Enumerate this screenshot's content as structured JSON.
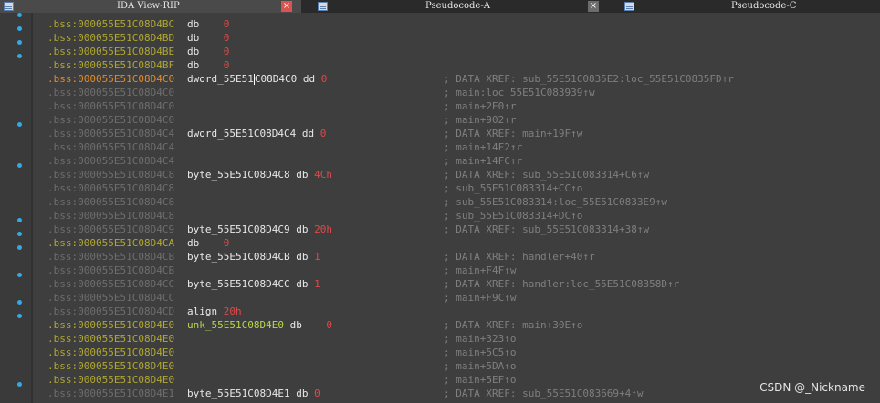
{
  "tabs": [
    {
      "label": "IDA View-RIP",
      "close": "×"
    },
    {
      "label": "Pseudocode-A",
      "close": "×"
    },
    {
      "label": "Pseudocode-C"
    }
  ],
  "rows": [
    {
      "addr": ".bss:000055E51C08D4BC",
      "addr_style": "bright",
      "name": "",
      "dir": "db",
      "val": "0",
      "cmt": "",
      "dot": true
    },
    {
      "addr": ".bss:000055E51C08D4BD",
      "addr_style": "bright",
      "name": "",
      "dir": "db",
      "val": "0",
      "cmt": "",
      "dot": true
    },
    {
      "addr": ".bss:000055E51C08D4BE",
      "addr_style": "bright",
      "name": "",
      "dir": "db",
      "val": "0",
      "cmt": "",
      "dot": true
    },
    {
      "addr": ".bss:000055E51C08D4BF",
      "addr_style": "bright",
      "name": "",
      "dir": "db",
      "val": "0",
      "cmt": "",
      "dot": true
    },
    {
      "addr": ".bss:000055E51C08D4C0",
      "addr_style": "sel",
      "name": "dword_55E51C08D4C0",
      "dir": "dd",
      "val": "0",
      "cmt": "; DATA XREF: sub_55E51C0835E2:loc_55E51C0835FD↑r",
      "dot": false,
      "cursor": true
    },
    {
      "addr": ".bss:000055E51C08D4C0",
      "addr_style": "dim",
      "name": "",
      "dir": "",
      "val": "",
      "cmt": "; main:loc_55E51C083939↑w",
      "dot": false
    },
    {
      "addr": ".bss:000055E51C08D4C0",
      "addr_style": "dim",
      "name": "",
      "dir": "",
      "val": "",
      "cmt": "; main+2E0↑r",
      "dot": false
    },
    {
      "addr": ".bss:000055E51C08D4C0",
      "addr_style": "dim",
      "name": "",
      "dir": "",
      "val": "",
      "cmt": "; main+902↑r",
      "dot": false
    },
    {
      "addr": ".bss:000055E51C08D4C4",
      "addr_style": "dim",
      "name": "dword_55E51C08D4C4",
      "dir": "dd",
      "val": "0",
      "cmt": "; DATA XREF: main+19F↑w",
      "dot": true
    },
    {
      "addr": ".bss:000055E51C08D4C4",
      "addr_style": "dim",
      "name": "",
      "dir": "",
      "val": "",
      "cmt": "; main+14F2↑r",
      "dot": false
    },
    {
      "addr": ".bss:000055E51C08D4C4",
      "addr_style": "dim",
      "name": "",
      "dir": "",
      "val": "",
      "cmt": "; main+14FC↑r",
      "dot": false
    },
    {
      "addr": ".bss:000055E51C08D4C8",
      "addr_style": "dim",
      "name": "byte_55E51C08D4C8",
      "dir": "db",
      "val": "4Ch",
      "cmt": "; DATA XREF: sub_55E51C083314+C6↑w",
      "dot": true
    },
    {
      "addr": ".bss:000055E51C08D4C8",
      "addr_style": "dim",
      "name": "",
      "dir": "",
      "val": "",
      "cmt": "; sub_55E51C083314+CC↑o",
      "dot": false
    },
    {
      "addr": ".bss:000055E51C08D4C8",
      "addr_style": "dim",
      "name": "",
      "dir": "",
      "val": "",
      "cmt": "; sub_55E51C083314:loc_55E51C0833E9↑w",
      "dot": false
    },
    {
      "addr": ".bss:000055E51C08D4C8",
      "addr_style": "dim",
      "name": "",
      "dir": "",
      "val": "",
      "cmt": "; sub_55E51C083314+DC↑o",
      "dot": false
    },
    {
      "addr": ".bss:000055E51C08D4C9",
      "addr_style": "dim",
      "name": "byte_55E51C08D4C9",
      "dir": "db",
      "val": "20h",
      "cmt": "; DATA XREF: sub_55E51C083314+38↑w",
      "dot": true
    },
    {
      "addr": ".bss:000055E51C08D4CA",
      "addr_style": "bright",
      "name": "",
      "dir": "db",
      "val": "0",
      "cmt": "",
      "dot": true
    },
    {
      "addr": ".bss:000055E51C08D4CB",
      "addr_style": "dim",
      "name": "byte_55E51C08D4CB",
      "dir": "db",
      "val": "1",
      "cmt": "; DATA XREF: handler+40↑r",
      "dot": true
    },
    {
      "addr": ".bss:000055E51C08D4CB",
      "addr_style": "dim",
      "name": "",
      "dir": "",
      "val": "",
      "cmt": "; main+F4F↑w",
      "dot": false
    },
    {
      "addr": ".bss:000055E51C08D4CC",
      "addr_style": "dim",
      "name": "byte_55E51C08D4CC",
      "dir": "db",
      "val": "1",
      "cmt": "; DATA XREF: handler:loc_55E51C08358D↑r",
      "dot": true
    },
    {
      "addr": ".bss:000055E51C08D4CC",
      "addr_style": "dim",
      "name": "",
      "dir": "",
      "val": "",
      "cmt": "; main+F9C↑w",
      "dot": false
    },
    {
      "addr": ".bss:000055E51C08D4CD",
      "addr_style": "dim",
      "name": "",
      "dir": "align",
      "val": "20h",
      "cmt": "",
      "dot": true,
      "align": true
    },
    {
      "addr": ".bss:000055E51C08D4E0",
      "addr_style": "bright",
      "name": "unk_55E51C08D4E0",
      "dir": "db",
      "val": "0",
      "cmt": "; DATA XREF: main+30E↑o",
      "dot": true,
      "unk": true
    },
    {
      "addr": ".bss:000055E51C08D4E0",
      "addr_style": "bright",
      "name": "",
      "dir": "",
      "val": "",
      "cmt": "; main+323↑o",
      "dot": false
    },
    {
      "addr": ".bss:000055E51C08D4E0",
      "addr_style": "bright",
      "name": "",
      "dir": "",
      "val": "",
      "cmt": "; main+5C5↑o",
      "dot": false
    },
    {
      "addr": ".bss:000055E51C08D4E0",
      "addr_style": "bright",
      "name": "",
      "dir": "",
      "val": "",
      "cmt": "; main+5DA↑o",
      "dot": false
    },
    {
      "addr": ".bss:000055E51C08D4E0",
      "addr_style": "bright",
      "name": "",
      "dir": "",
      "val": "",
      "cmt": "; main+5EF↑o",
      "dot": false
    },
    {
      "addr": ".bss:000055E51C08D4E1",
      "addr_style": "dim",
      "name": "byte_55E51C08D4E1",
      "dir": "db",
      "val": "0",
      "cmt": "; DATA XREF: sub_55E51C083669+4↑w",
      "dot": true
    }
  ],
  "watermark": "CSDN @_Nickname",
  "colors": {
    "background": "#3e3e3e",
    "address_dim": "#6e6e6e",
    "address_bright": "#b0a830",
    "address_selected": "#e38b2a",
    "value": "#e04848",
    "comment": "#7f7f7f",
    "gutter_dot": "#36a9e1",
    "unk_name": "#b7d84a"
  }
}
